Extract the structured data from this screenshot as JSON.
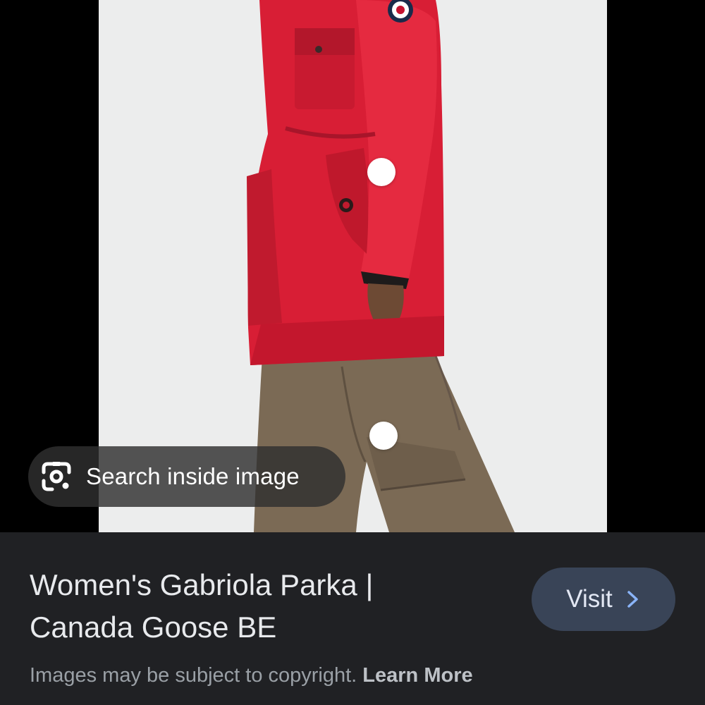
{
  "viewer": {
    "image_subject": "Model wearing red parka and brown trousers",
    "search_inside_image_label": "Search inside image"
  },
  "result": {
    "title_line1": "Women's Gabriola Parka |",
    "title_line2": "Canada Goose BE",
    "visit_label": "Visit"
  },
  "footer": {
    "copyright_text": "Images may be subject to copyright.",
    "learn_more_label": "Learn More"
  },
  "colors": {
    "panel_background": "#202124",
    "visit_button": "#394457",
    "visit_chevron": "#8ab4f8",
    "parka_red": "#d81e35",
    "trousers_brown": "#7b6a55"
  },
  "icons": [
    "google-lens-icon",
    "chevron-right-icon"
  ]
}
